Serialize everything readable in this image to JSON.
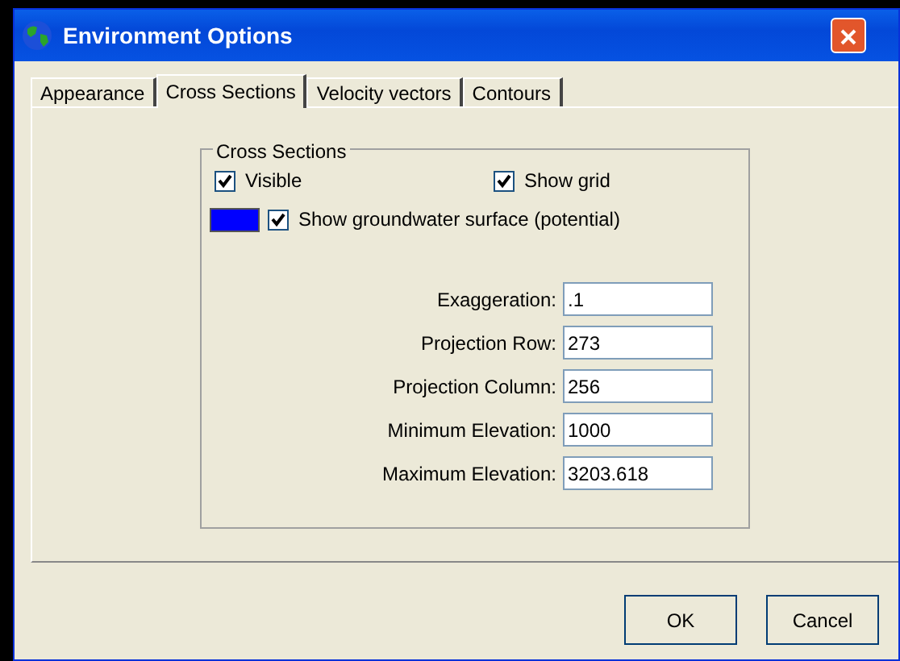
{
  "window": {
    "title": "Environment Options"
  },
  "tabs": [
    {
      "label": "Appearance",
      "selected": false
    },
    {
      "label": "Cross Sections",
      "selected": true
    },
    {
      "label": "Velocity vectors",
      "selected": false
    },
    {
      "label": "Contours",
      "selected": false
    }
  ],
  "group": {
    "title": "Cross Sections",
    "checks": [
      {
        "label": "Visible",
        "checked": true
      },
      {
        "label": "Show grid",
        "checked": true
      }
    ],
    "surface": {
      "color": "#0000ff",
      "label": "Show groundwater surface (potential)",
      "checked": true
    },
    "fields": [
      {
        "label": "Exaggeration:",
        "value": ".1"
      },
      {
        "label": "Projection Row:",
        "value": "273"
      },
      {
        "label": "Projection Column:",
        "value": "256"
      },
      {
        "label": "Minimum Elevation:",
        "value": "1000"
      },
      {
        "label": "Maximum Elevation:",
        "value": "3203.618"
      }
    ]
  },
  "buttons": [
    "OK",
    "Cancel"
  ]
}
